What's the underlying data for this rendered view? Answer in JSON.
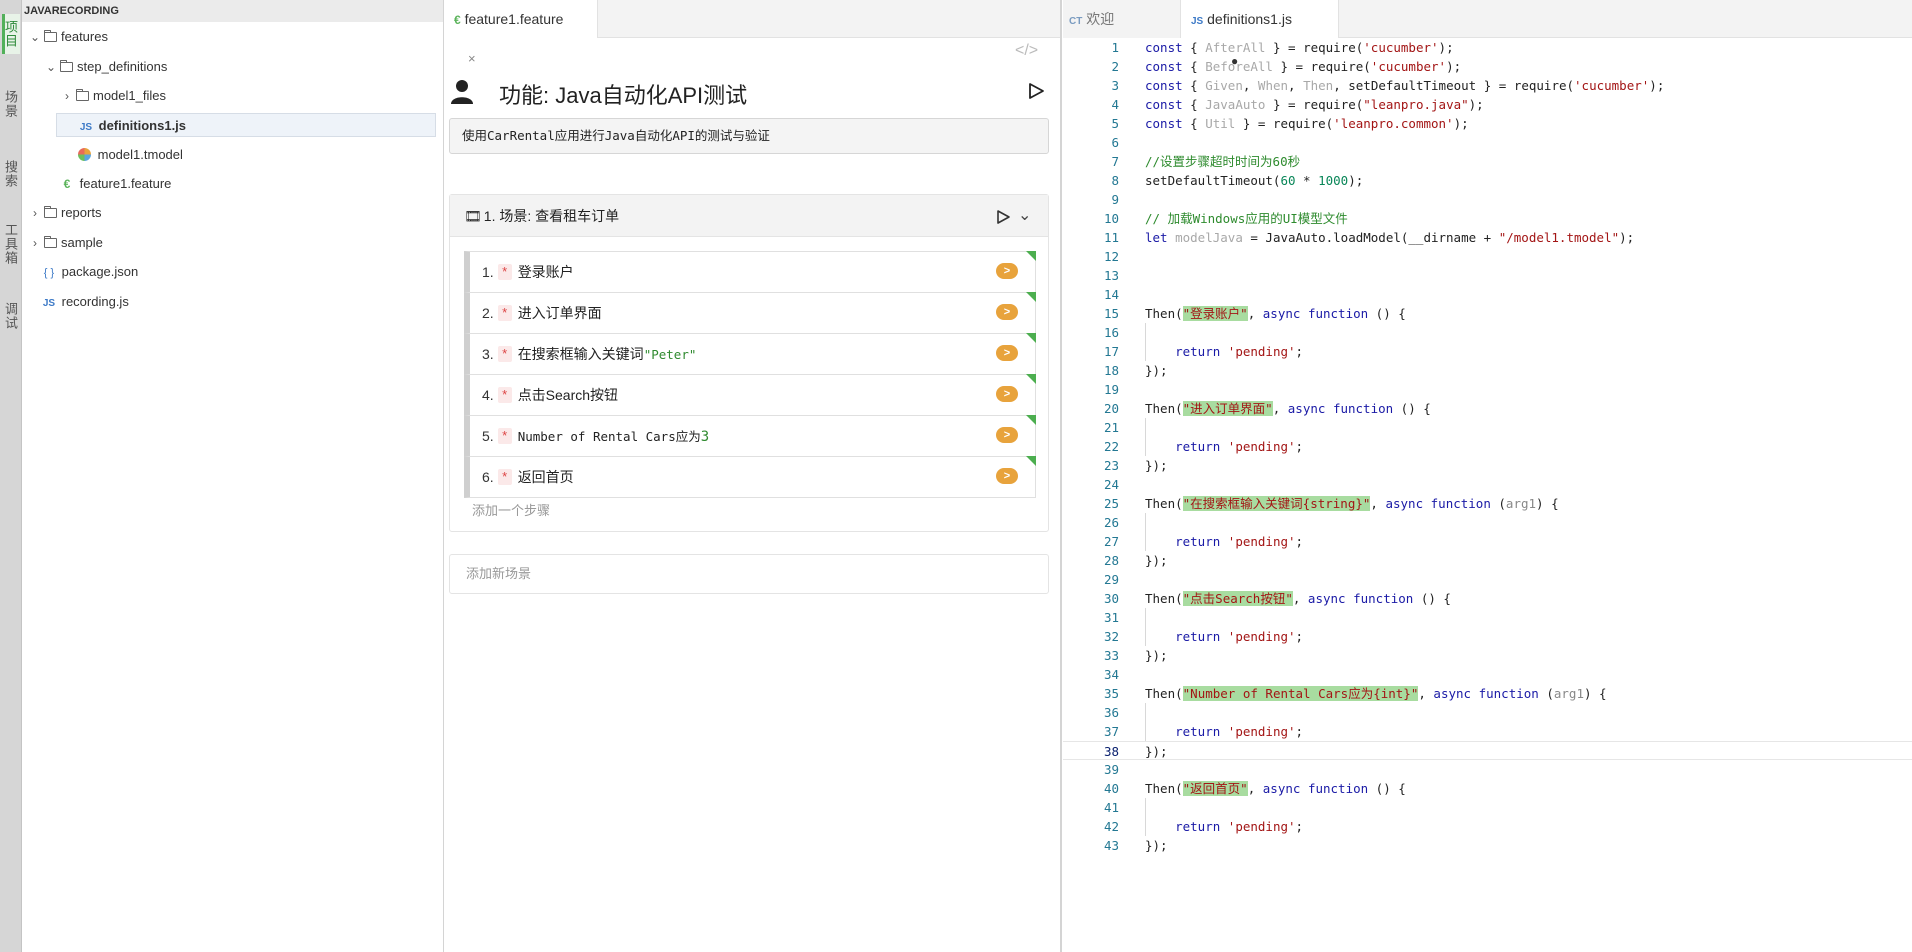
{
  "activity": {
    "tabs": [
      "项目",
      "场景",
      "搜索",
      "工具箱",
      "调试"
    ]
  },
  "explorer": {
    "title": "JAVARECORDING",
    "items": [
      {
        "label": "features",
        "type": "folder",
        "expanded": true
      },
      {
        "label": "step_definitions",
        "type": "folder",
        "expanded": true
      },
      {
        "label": "model1_files",
        "type": "folder",
        "expanded": false
      },
      {
        "label": "definitions1.js",
        "type": "js",
        "selected": true
      },
      {
        "label": "model1.tmodel",
        "type": "tmodel"
      },
      {
        "label": "feature1.feature",
        "type": "feature"
      },
      {
        "label": "reports",
        "type": "folder",
        "expanded": false
      },
      {
        "label": "sample",
        "type": "folder",
        "expanded": false
      },
      {
        "label": "package.json",
        "type": "json"
      },
      {
        "label": "recording.js",
        "type": "js"
      }
    ]
  },
  "feature_pane": {
    "tab_label": "feature1.feature",
    "tab_close": "×",
    "code_toggle": "</>",
    "feature_title": "功能: Java自动化API测试",
    "description": "使用CarRental应用进行Java自动化API的测试与验证",
    "scenario": {
      "title": "1. 场景: 查看租车订单",
      "steps": [
        {
          "num": "1.",
          "text": "登录账户"
        },
        {
          "num": "2.",
          "text": "进入订单界面"
        },
        {
          "num": "3.",
          "text": "在搜索框输入关键词",
          "arg": "\"Peter\""
        },
        {
          "num": "4.",
          "text": "点击Search按钮"
        },
        {
          "num": "5.",
          "text": "Number of Rental Cars应为",
          "arg_num": "3"
        },
        {
          "num": "6.",
          "text": "返回首页"
        }
      ],
      "star": "*",
      "go_label": ">",
      "add_step": "添加一个步骤"
    },
    "add_scenario": "添加新场景"
  },
  "code_pane": {
    "tabs": [
      {
        "icon": "CT",
        "label": "欢迎",
        "active": false
      },
      {
        "icon": "JS",
        "label": "definitions1.js",
        "active": true,
        "modified": "●"
      }
    ],
    "current_line": 38,
    "lines": [
      "const { AfterAll } = require('cucumber');",
      "const { BeforeAll } = require('cucumber');",
      "const { Given, When, Then, setDefaultTimeout } = require('cucumber');",
      "const { JavaAuto } = require(\"leanpro.java\");",
      "const { Util } = require('leanpro.common');",
      "",
      "//设置步骤超时时间为60秒",
      "setDefaultTimeout(60 * 1000);",
      "",
      "// 加载Windows应用的UI模型文件",
      "let modelJava = JavaAuto.loadModel(__dirname + \"/model1.tmodel\");",
      "",
      "",
      "",
      "Then(\"登录账户\", async function () {",
      "",
      "    return 'pending';",
      "});",
      "",
      "Then(\"进入订单界面\", async function () {",
      "",
      "    return 'pending';",
      "});",
      "",
      "Then(\"在搜索框输入关键词{string}\", async function (arg1) {",
      "",
      "    return 'pending';",
      "});",
      "",
      "Then(\"点击Search按钮\", async function () {",
      "",
      "    return 'pending';",
      "});",
      "",
      "Then(\"Number of Rental Cars应为{int}\", async function (arg1) {",
      "",
      "    return 'pending';",
      "});",
      "",
      "Then(\"返回首页\", async function () {",
      "",
      "    return 'pending';",
      "});"
    ]
  }
}
